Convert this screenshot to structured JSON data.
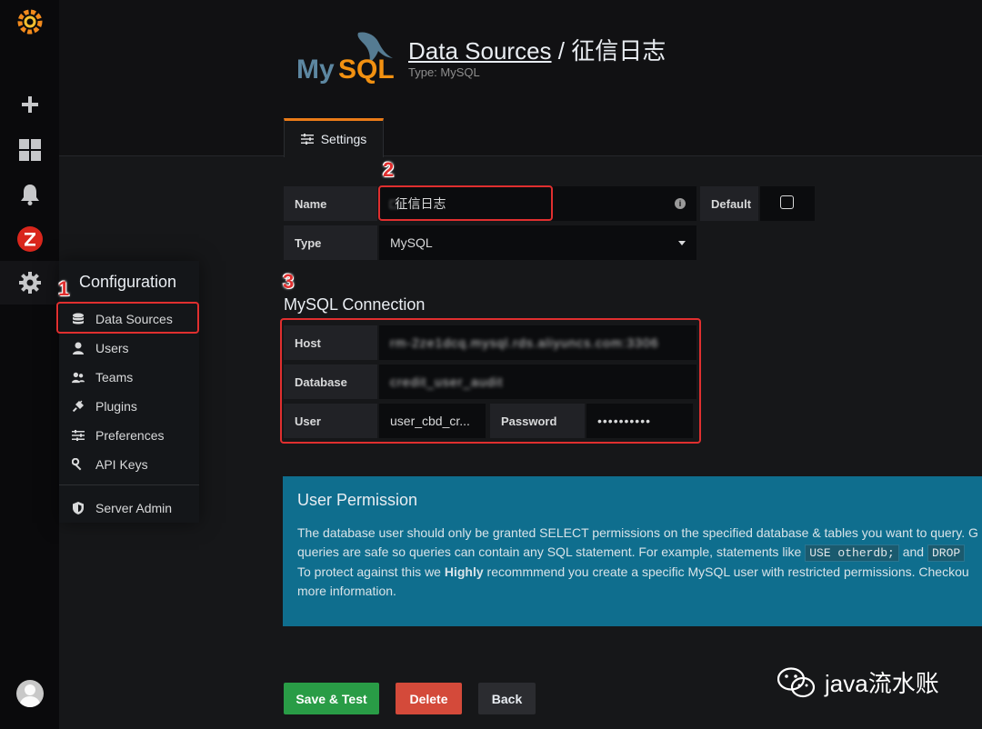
{
  "sidebar": {
    "icons": [
      "grafana-logo-icon",
      "plus-icon",
      "dashboards-icon",
      "bell-icon",
      "zabbix-icon",
      "gear-icon",
      "avatar"
    ]
  },
  "config_menu": {
    "title": "Configuration",
    "items": [
      {
        "label": "Data Sources",
        "icon": "database-icon"
      },
      {
        "label": "Users",
        "icon": "user-icon"
      },
      {
        "label": "Teams",
        "icon": "users-icon"
      },
      {
        "label": "Plugins",
        "icon": "plug-icon"
      },
      {
        "label": "Preferences",
        "icon": "sliders-icon"
      },
      {
        "label": "API Keys",
        "icon": "key-icon"
      },
      {
        "label": "Server Admin",
        "icon": "shield-icon"
      }
    ]
  },
  "header": {
    "title_link": "Data Sources",
    "title_rest": " / 征信日志",
    "subtitle": "Type: MySQL",
    "logo_text": "MySQL",
    "tab": "Settings"
  },
  "annotations": [
    "1",
    "2",
    "3"
  ],
  "form": {
    "name_label": "Name",
    "name_value": "征信日志",
    "default_label": "Default",
    "type_label": "Type",
    "type_value": "MySQL",
    "section_title": "MySQL Connection",
    "host_label": "Host",
    "host_value": "rm-2ze1dcq.mysql.rds.aliyuncs.com:3306",
    "database_label": "Database",
    "database_value": "credit_user_audit",
    "user_label": "User",
    "user_value": "user_cbd_cr...",
    "password_label": "Password",
    "password_value": "••••••••••"
  },
  "info": {
    "title": "User Permission",
    "line1": "The database user should only be granted SELECT permissions on the specified database & tables you want to query. G",
    "line2_a": "queries are safe so queries can contain any SQL statement. For example, statements like ",
    "code1": "USE otherdb;",
    "line2_b": " and ",
    "code2": "DROP",
    "line3_a": "To protect against this we ",
    "line3_bold": "Highly",
    "line3_b": " recommmend you create a specific MySQL user with restricted permissions. Checkou",
    "line4": "more information."
  },
  "buttons": {
    "save": "Save & Test",
    "delete": "Delete",
    "back": "Back"
  },
  "watermark": "java流水账",
  "colors": {
    "accent_orange": "#eb7b18",
    "annotation_red": "#e02f2f",
    "info_blue": "#0f6e8e",
    "save_green": "#299c46",
    "delete_red": "#d44a3a"
  }
}
